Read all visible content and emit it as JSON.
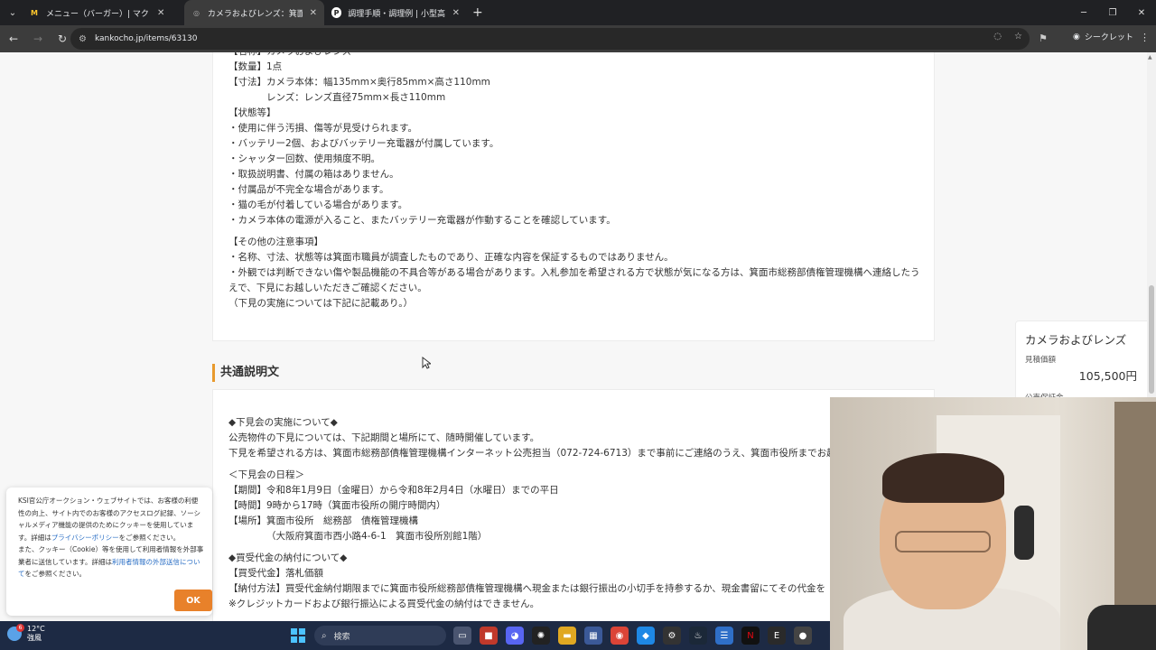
{
  "browser": {
    "tabs": [
      {
        "title": "メニュー（バーガー）| マクドナルド公式",
        "active": false
      },
      {
        "title": "カメラおよびレンズ：箕面市のインターネット公売",
        "active": true
      },
      {
        "title": "調理手順・調理例 | 小型高温高圧",
        "active": false
      }
    ],
    "url": "kankocho.jp/items/63130",
    "incognito_label": "シークレット"
  },
  "item_details": {
    "lines_a": [
      "【名称】カメラおよびレンズ",
      "【数量】1点",
      "【寸法】カメラ本体：幅135mm×奥行85mm×高さ110mm"
    ],
    "dim_indent": "レンズ：レンズ直径75mm×長さ110mm",
    "lines_b": [
      "【状態等】",
      "・使用に伴う汚損、傷等が見受けられます。",
      "・バッテリー2個、およびバッテリー充電器が付属しています。",
      "・シャッター回数、使用頻度不明。",
      "・取扱説明書、付属の箱はありません。",
      "・付属品が不完全な場合があります。",
      "・猫の毛が付着している場合があります。",
      "・カメラ本体の電源が入ること、またバッテリー充電器が作動することを確認しています。"
    ],
    "lines_c": [
      "【その他の注意事項】",
      "・名称、寸法、状態等は箕面市職員が調査したものであり、正確な内容を保証するものではありません。"
    ],
    "wrap_line": "・外観では判断できない傷や製品機能の不具合等がある場合があります。入札参加を希望される方で状態が気になる方は、箕面市総務部債権管理機構へ連絡したうえで、下見にお越しいただきご確認ください。",
    "last_line": "（下見の実施については下記に記載あり。）"
  },
  "common_section": {
    "heading": "共通説明文",
    "preview_head": "◆下見会の実施について◆",
    "preview_lines": [
      "公売物件の下見については、下記期間と場所にて、随時開催しています。",
      "下見を希望される方は、箕面市総務部債権管理機構インターネット公売担当（072-724-6713）まで事前にご連絡のうえ、箕面市役所までお越"
    ],
    "schedule_head": "＜下見会の日程＞",
    "schedule_lines": [
      "【期間】令和8年1月9日（金曜日）から令和8年2月4日（水曜日）までの平日",
      "【時間】9時から17時（箕面市役所の開庁時間内）",
      "【場所】箕面市役所　総務部　債権管理機構"
    ],
    "address": "（大阪府箕面市西小路4-6-1　箕面市役所別館1階）",
    "payment_head": "◆買受代金の納付について◆",
    "payment_lines": [
      "【買受代金】落札価額",
      "【納付方法】買受代金納付期限までに箕面市役所総務部債権管理機構へ現金または銀行振出の小切手を持参するか、現金書留にてその代金を",
      "※クレジットカードおよび銀行振込による買受代金の納付はできません。"
    ]
  },
  "side_card": {
    "name": "カメラおよびレンズ",
    "estimate_label": "見積価額",
    "estimate_value": "105,500円",
    "deposit_label": "公売保証金"
  },
  "cookie": {
    "text_1": "KSI官公庁オークション・ウェブサイトでは、お客様の利便性の向上、サイト内でのお客様のアクセスログ記録、ソーシャルメディア機能の提供のためにクッキーを使用しています。詳細は",
    "link_1": "プライバシーポリシー",
    "text_2": "をご参照ください。",
    "text_3": "また、クッキー（Cookie）等を使用して利用者情報を外部事業者に送信しています。詳細は",
    "link_2": "利用者情報の外部送信について",
    "text_4": "をご参照ください。",
    "ok_label": "OK"
  },
  "taskbar": {
    "temperature": "12°C",
    "weather": "強風",
    "notification_count": "6",
    "search_placeholder": "検索"
  },
  "colors": {
    "accent": "#e89a2e",
    "ok_button": "#e8812a",
    "link": "#2b6fc5"
  }
}
